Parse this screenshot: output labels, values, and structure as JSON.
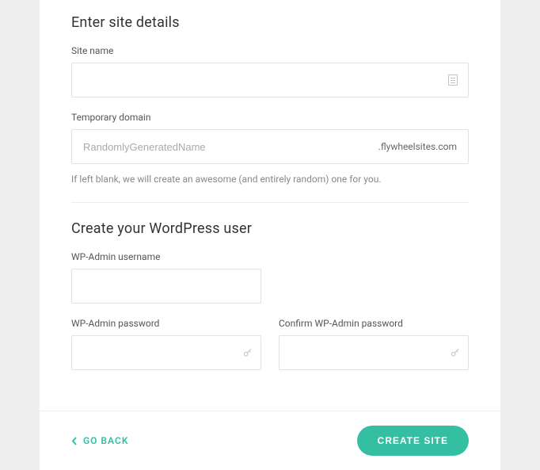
{
  "section1": {
    "title": "Enter site details",
    "siteName": {
      "label": "Site name",
      "value": ""
    },
    "tempDomain": {
      "label": "Temporary domain",
      "placeholder": "RandomlyGeneratedName",
      "suffix": ".flywheelsites.com",
      "value": ""
    },
    "hint": "If left blank, we will create an awesome (and entirely random) one for you."
  },
  "section2": {
    "title": "Create your WordPress user",
    "username": {
      "label": "WP-Admin username",
      "value": ""
    },
    "password": {
      "label": "WP-Admin password",
      "value": ""
    },
    "confirm": {
      "label": "Confirm WP-Admin password",
      "value": ""
    }
  },
  "footer": {
    "back": "GO BACK",
    "create": "CREATE SITE"
  }
}
